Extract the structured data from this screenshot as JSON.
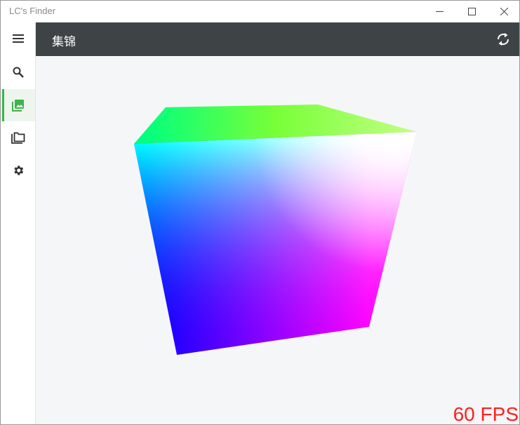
{
  "window": {
    "title": "LC's Finder"
  },
  "header": {
    "title": "集锦"
  },
  "sidebar": {
    "items": [
      {
        "icon": "menu-icon"
      },
      {
        "icon": "search-icon"
      },
      {
        "icon": "gallery-icon",
        "active": true
      },
      {
        "icon": "folders-icon"
      },
      {
        "icon": "gear-icon"
      }
    ],
    "accent": "#3bb54a"
  },
  "colors": {
    "header_bg": "#3e4446",
    "content_bg": "#f5f6f8",
    "fps": "#ff2020"
  },
  "status": {
    "fps": "60 FPS"
  }
}
